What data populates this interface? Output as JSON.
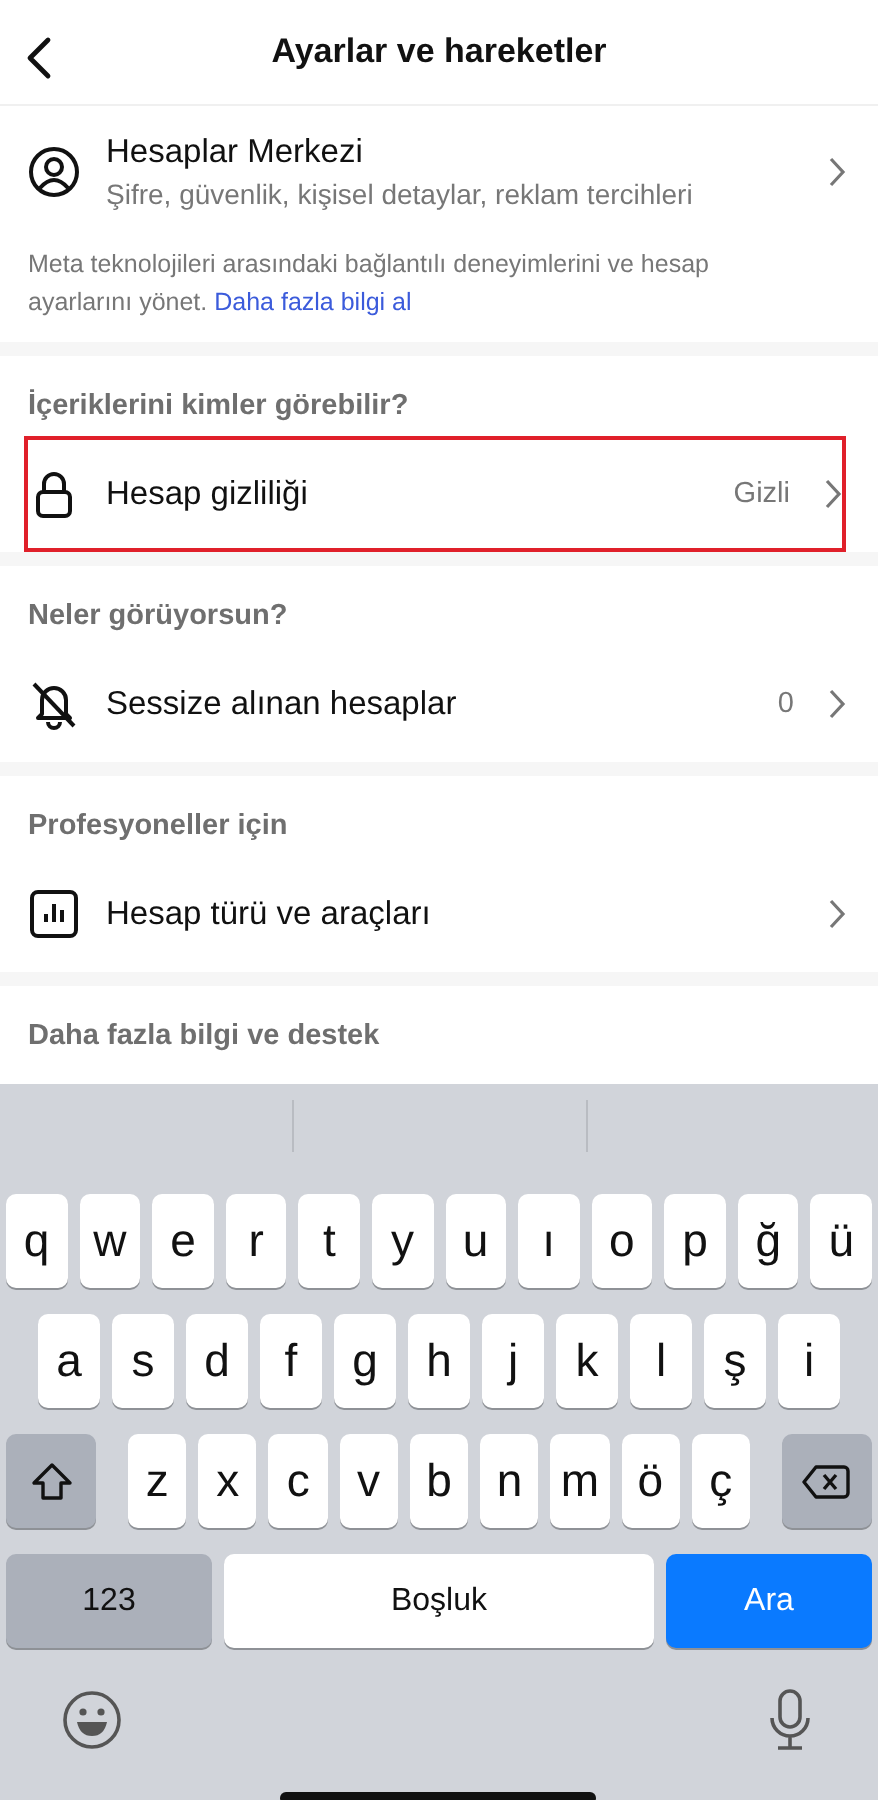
{
  "header": {
    "title": "Ayarlar ve hareketler"
  },
  "accounts": {
    "title": "Hesaplar Merkezi",
    "subtitle": "Şifre, güvenlik, kişisel detaylar, reklam tercihleri",
    "note": "Meta teknolojileri arasındaki bağlantılı deneyimlerini ve hesap ayarlarını yönet.",
    "link": "Daha fazla bilgi al"
  },
  "sections": [
    {
      "heading": "İçeriklerini kimler görebilir?",
      "row": {
        "label": "Hesap gizliliği",
        "value": "Gizli",
        "highlighted": true
      }
    },
    {
      "heading": "Neler görüyorsun?",
      "row": {
        "label": "Sessize alınan hesaplar",
        "value": "0",
        "highlighted": false
      }
    },
    {
      "heading": "Profesyoneller için",
      "row": {
        "label": "Hesap türü ve araçları",
        "highlighted": false
      }
    },
    {
      "heading": "Daha fazla bilgi ve destek"
    }
  ],
  "keyboard": {
    "rows": [
      [
        "q",
        "w",
        "e",
        "r",
        "t",
        "y",
        "u",
        "ı",
        "o",
        "p",
        "ğ",
        "ü"
      ],
      [
        "a",
        "s",
        "d",
        "f",
        "g",
        "h",
        "j",
        "k",
        "l",
        "ş",
        "i"
      ],
      [
        "z",
        "x",
        "c",
        "v",
        "b",
        "n",
        "m",
        "ö",
        "ç"
      ]
    ],
    "numbers": "123",
    "space": "Boşluk",
    "action": "Ara"
  }
}
